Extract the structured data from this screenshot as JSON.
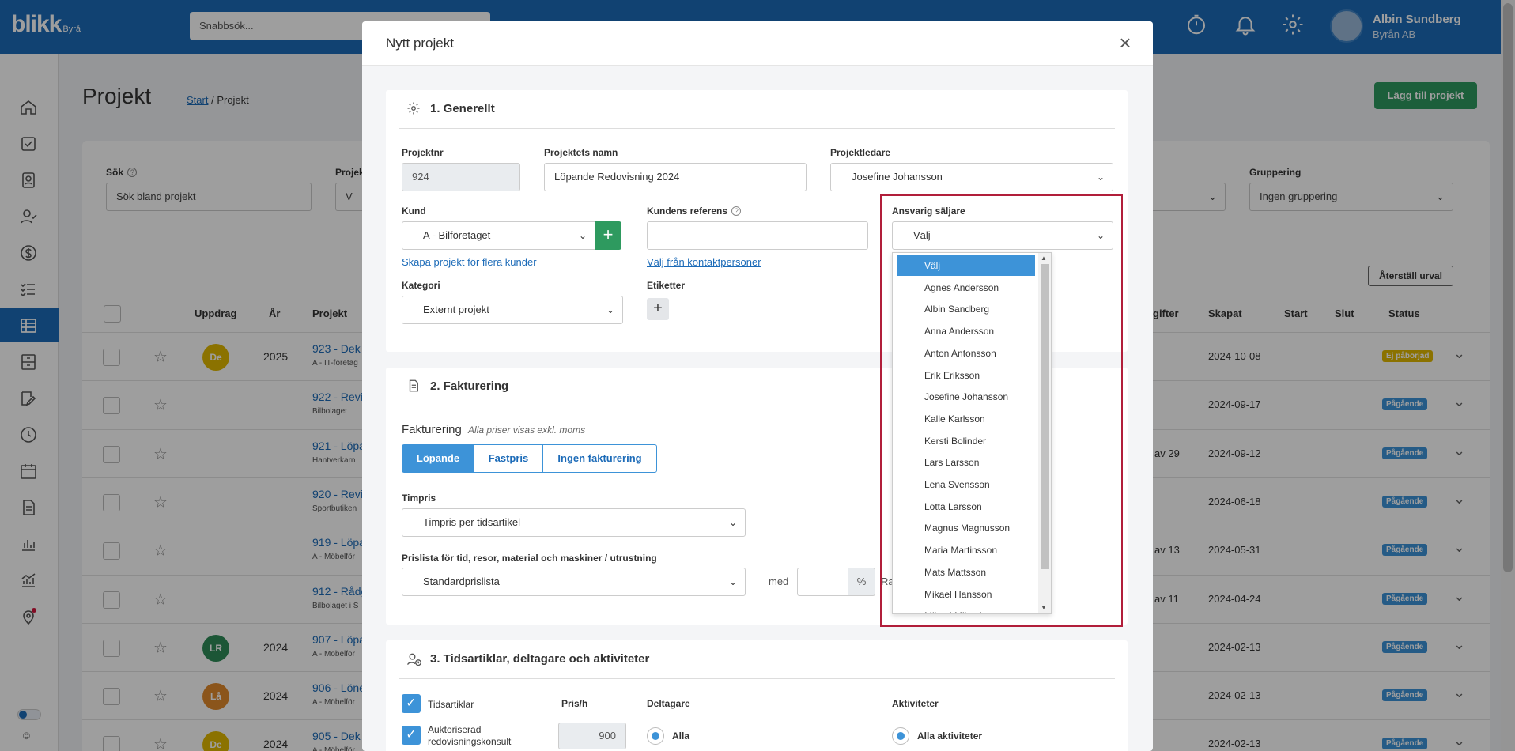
{
  "app": {
    "logo": "blikk",
    "logo_sub": "Byrå",
    "quick_search_placeholder": "Snabbsök...",
    "user_name": "Albin Sundberg",
    "user_company": "Byrån AB",
    "copyright": "©"
  },
  "sidebar": {
    "items": [
      {
        "icon": "home-icon"
      },
      {
        "icon": "checkbox-icon"
      },
      {
        "icon": "contact-card-icon"
      },
      {
        "icon": "user-check-icon"
      },
      {
        "icon": "dollar-icon"
      },
      {
        "icon": "list-check-icon"
      },
      {
        "icon": "table-icon",
        "active": true
      },
      {
        "icon": "archive-icon"
      },
      {
        "icon": "edit-document-icon"
      },
      {
        "icon": "clock-icon"
      },
      {
        "icon": "calendar-icon"
      },
      {
        "icon": "document-icon"
      },
      {
        "icon": "bar-chart-icon"
      },
      {
        "icon": "analytics-icon"
      },
      {
        "icon": "location-pin-icon"
      }
    ]
  },
  "page": {
    "title": "Projekt",
    "breadcrumb_start": "Start",
    "breadcrumb_sep": " / ",
    "breadcrumb_current": "Projekt",
    "add_button": "Lägg till projekt",
    "filters": {
      "search_label": "Sök",
      "search_placeholder": "Sök bland projekt",
      "project_label_partial": "Projek",
      "project_value_partial": "V",
      "grouping_label": "Gruppering",
      "grouping_value": "Ingen gruppering",
      "reset_button": "Återställ urval"
    },
    "table_headers": {
      "uppdrag": "Uppdrag",
      "ar": "År",
      "projekt": "Projekt",
      "avgifter_partial": "gifter",
      "skapat": "Skapat",
      "start": "Start",
      "slut": "Slut",
      "status": "Status"
    },
    "rows": [
      {
        "badge": "De",
        "badge_color": "#e0b800",
        "year": "2025",
        "name": "923 - Dek",
        "sub": "A - IT-företag",
        "av": "",
        "created": "2024-10-08",
        "status": "Ej påbörjad",
        "status_color": "#e0b800"
      },
      {
        "badge": "",
        "badge_color": "",
        "year": "",
        "name": "922 - Revi",
        "sub": "Bilbolaget",
        "av": "",
        "created": "2024-09-17",
        "status": "Pågående",
        "status_color": "#3d93d8"
      },
      {
        "badge": "",
        "badge_color": "",
        "year": "",
        "name": "921 - Löpa",
        "sub": "Hantverkarn",
        "av": "av 29",
        "created": "2024-09-12",
        "status": "Pågående",
        "status_color": "#3d93d8"
      },
      {
        "badge": "",
        "badge_color": "",
        "year": "",
        "name": "920 - Revi",
        "sub": "Sportbutiken",
        "av": "",
        "created": "2024-06-18",
        "status": "Pågående",
        "status_color": "#3d93d8"
      },
      {
        "badge": "",
        "badge_color": "",
        "year": "",
        "name": "919 - Löpa",
        "sub": "A - Möbelför",
        "av": "av 13",
        "created": "2024-05-31",
        "status": "Pågående",
        "status_color": "#3d93d8"
      },
      {
        "badge": "",
        "badge_color": "",
        "year": "",
        "name": "912 - Rådg",
        "sub": "Bilbolaget i S",
        "av": "av 11",
        "created": "2024-04-24",
        "status": "Pågående",
        "status_color": "#3d93d8"
      },
      {
        "badge": "LR",
        "badge_color": "#2e8b57",
        "year": "2024",
        "name": "907 - Löpa",
        "sub": "A - Möbelför",
        "av": "",
        "created": "2024-02-13",
        "status": "Pågående",
        "status_color": "#3d93d8"
      },
      {
        "badge": "Lå",
        "badge_color": "#e08a2c",
        "year": "2024",
        "name": "906 - Löne",
        "sub": "A - Möbelför",
        "av": "",
        "created": "2024-02-13",
        "status": "Pågående",
        "status_color": "#3d93d8"
      },
      {
        "badge": "De",
        "badge_color": "#e0b800",
        "year": "2024",
        "name": "905 - Dek",
        "sub": "A - Möbelför",
        "av": "",
        "created": "2024-02-13",
        "status": "Pågående",
        "status_color": "#3d93d8"
      }
    ]
  },
  "modal": {
    "title": "Nytt projekt",
    "close": "×",
    "s1": {
      "title": "1. Generellt",
      "projektnr_label": "Projektnr",
      "projektnr_value": "924",
      "namn_label": "Projektets namn",
      "namn_value": "Löpande Redovisning 2024",
      "ledare_label": "Projektledare",
      "ledare_value": "Josefine Johansson",
      "kund_label": "Kund",
      "kund_value": "A - Bilföretaget",
      "kund_plus": "+",
      "kund_link": "Skapa projekt för flera kunder",
      "referens_label": "Kundens referens",
      "referens_link": "Välj från kontaktpersoner",
      "saljare_label": "Ansvarig säljare",
      "saljare_value": "Välj",
      "kategori_label": "Kategori",
      "kategori_value": "Externt projekt",
      "etiketter_label": "Etiketter",
      "etiketter_plus": "+"
    },
    "s2": {
      "title": "2. Fakturering",
      "fakt_label": "Fakturering",
      "fakt_note": "Alla priser visas exkl. moms",
      "seg": [
        "Löpande",
        "Fastpris",
        "Ingen fakturering"
      ],
      "timpris_label": "Timpris",
      "timpris_value": "Timpris per tidsartikel",
      "prislista_label": "Prislista för tid, resor, material och maskiner / utrustning",
      "prislista_value": "Standardprislista",
      "med": "med",
      "pct": "%",
      "ra_partial": "Ra"
    },
    "s3": {
      "title": "3. Tidsartiklar, deltagare och aktiviteter",
      "tidsartiklar": "Tidsartiklar",
      "prish": "Pris/h",
      "item_name": "Auktoriserad redovisningskonsult",
      "item_price": "900",
      "deltagare": "Deltagare",
      "alla": "Alla",
      "aktiviteter": "Aktiviteter",
      "alla_aktiviteter": "Alla aktiviteter"
    }
  },
  "dropdown": {
    "options": [
      "Välj",
      "Agnes Andersson",
      "Albin Sandberg",
      "Anna Andersson",
      "Anton Antonsson",
      "Erik Eriksson",
      "Josefine Johansson",
      "Kalle Karlsson",
      "Kersti Bolinder",
      "Lars Larsson",
      "Lena Svensson",
      "Lotta Larsson",
      "Magnus Magnusson",
      "Maria Martinsson",
      "Mats Mattsson",
      "Mikael Hansson",
      "Mikael Mikaelsson"
    ],
    "selected": "Välj"
  }
}
